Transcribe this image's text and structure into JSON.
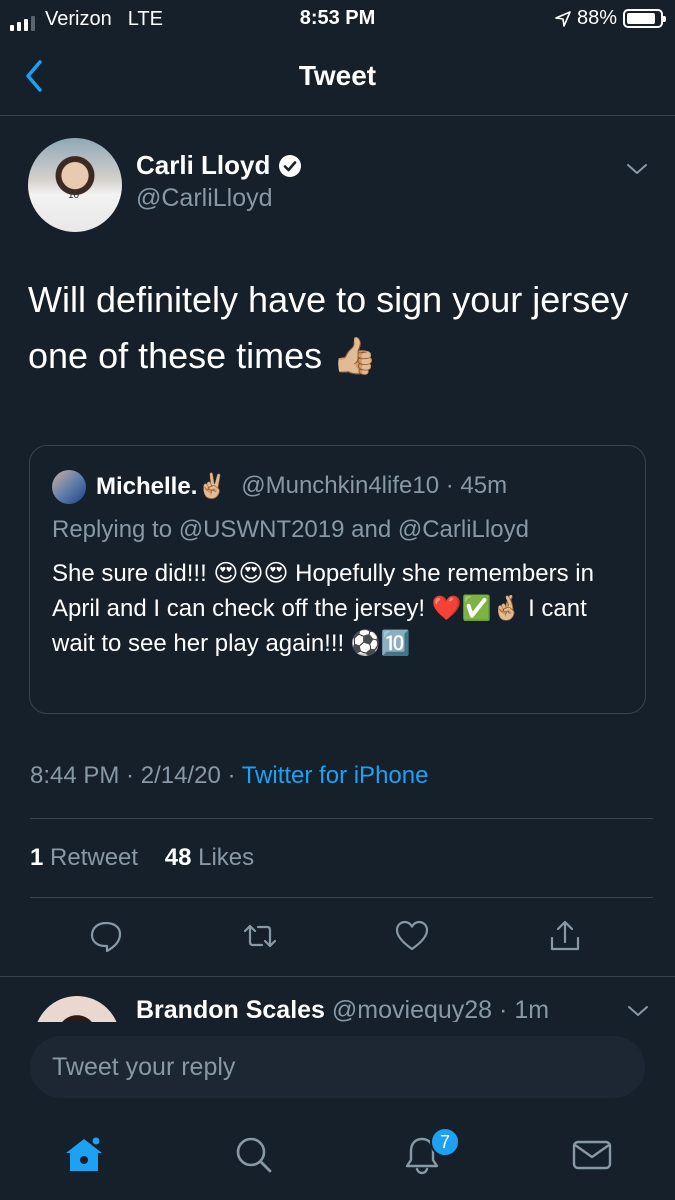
{
  "status_bar": {
    "carrier": "Verizon",
    "network": "LTE",
    "time": "8:53 PM",
    "battery": "88%",
    "battery_level": 0.88
  },
  "nav": {
    "title": "Tweet"
  },
  "tweet": {
    "author_name": "Carli Lloyd",
    "author_handle": "@CarliLloyd",
    "text": "Will definitely have to sign your jersey one of these times 👍🏼",
    "quote": {
      "name": "Michelle.✌🏼",
      "handle": "@Munchkin4life10",
      "age": "45m",
      "replying_to": "Replying to @USWNT2019 and @CarliLloyd",
      "text": "She sure did!!! 😍😍😍 Hopefully she remembers in April and I can check off the jersey! ❤️✅🤞🏼 I cant wait to see her play again!!! ⚽️🔟"
    },
    "time": "8:44 PM",
    "date": "2/14/20",
    "source": "Twitter for iPhone",
    "retweet_count": "1",
    "retweet_label": "Retweet",
    "like_count": "48",
    "like_label": "Likes"
  },
  "next_reply": {
    "name": "Brandon Scales",
    "handle": "@moviequy28",
    "age": "1m"
  },
  "reply_bar": {
    "placeholder": "Tweet your reply"
  },
  "tabbar": {
    "notifications_badge": "7"
  },
  "colors": {
    "background": "#15202b",
    "accent": "#1da1f2",
    "secondary_text": "#8899a6",
    "divider": "#38444d"
  }
}
